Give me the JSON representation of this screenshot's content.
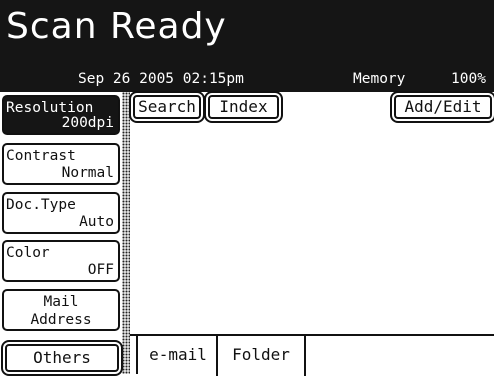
{
  "header": {
    "title": "Scan Ready",
    "datetime": "Sep 26 2005 02:15pm",
    "memory_label": "Memory",
    "memory_value": "100%"
  },
  "left_menu": {
    "resolution": {
      "label": "Resolution",
      "value": "200dpi"
    },
    "contrast": {
      "label": "Contrast",
      "value": "Normal"
    },
    "doc_type": {
      "label": "Doc.Type",
      "value": "Auto"
    },
    "color": {
      "label": "Color",
      "value": "OFF"
    },
    "mail_address": {
      "line1": "Mail",
      "line2": "Address"
    },
    "others": "Others"
  },
  "top_buttons": {
    "search": "Search",
    "index": "Index",
    "add_edit": "Add/Edit"
  },
  "bottom_tabs": {
    "email": "e-mail",
    "folder": "Folder"
  },
  "colors": {
    "header_bg": "#151515",
    "selected_bg": "#151515",
    "foreground": "#111111",
    "background": "#ffffff"
  }
}
